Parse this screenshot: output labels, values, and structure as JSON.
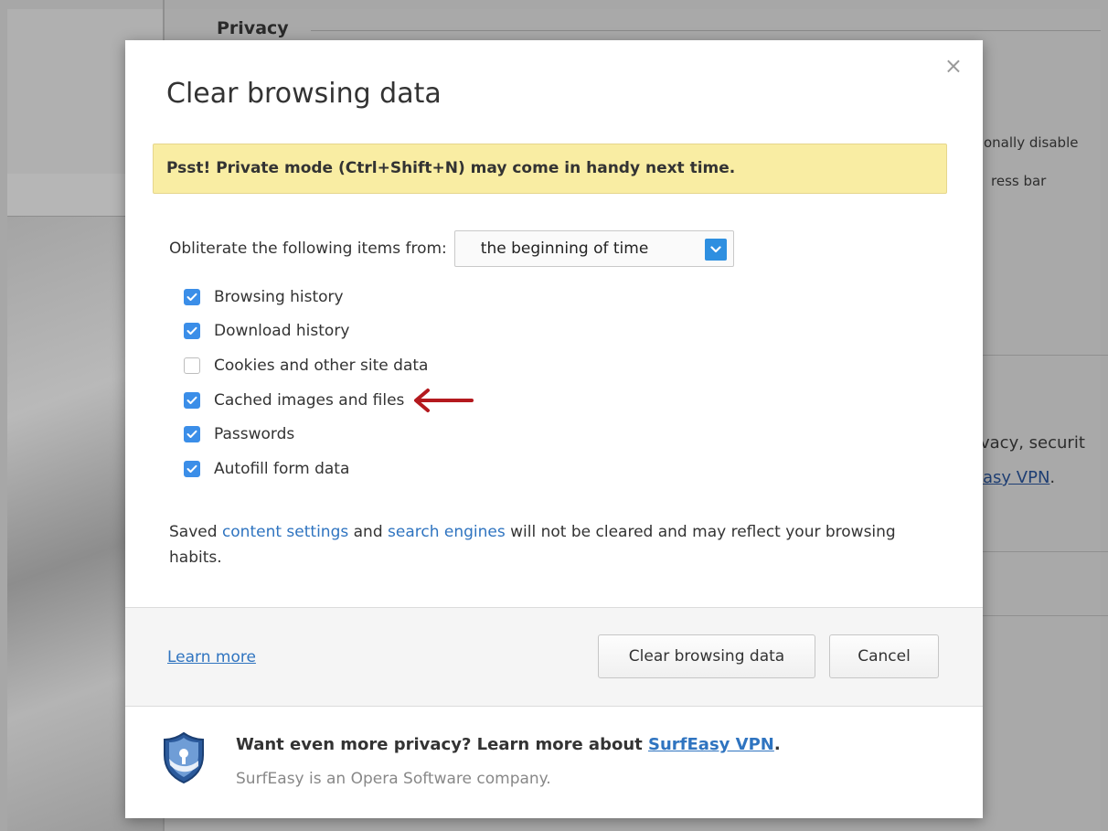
{
  "background": {
    "section_title": "Privacy",
    "fragment_1": "onally disable",
    "fragment_2": "ress bar",
    "fragment_3": "vacy, securit",
    "fragment_4_link": "asy VPN",
    "fragment_4_tail": "."
  },
  "dialog": {
    "title": "Clear browsing data",
    "close_glyph": "×",
    "notice": "Psst! Private mode (Ctrl+Shift+N) may come in handy next time.",
    "period_label": "Obliterate the following items from:",
    "period_value": "the beginning of time",
    "items": [
      {
        "label": "Browsing history",
        "checked": true
      },
      {
        "label": "Download history",
        "checked": true
      },
      {
        "label": "Cookies and other site data",
        "checked": false
      },
      {
        "label": "Cached images and files",
        "checked": true
      },
      {
        "label": "Passwords",
        "checked": true
      },
      {
        "label": "Autofill form data",
        "checked": true
      }
    ],
    "note": {
      "prefix": "Saved ",
      "link1": "content settings",
      "middle": " and ",
      "link2": "search engines",
      "suffix": " will not be cleared and may reflect your browsing habits."
    },
    "footer": {
      "learn_more": "Learn more",
      "clear_button": "Clear browsing data",
      "cancel_button": "Cancel"
    },
    "promo": {
      "headline": "Want even more privacy? Learn more about ",
      "link": "SurfEasy VPN",
      "headline_end": ".",
      "subtitle": "SurfEasy is an Opera Software company."
    }
  },
  "colors": {
    "accent_blue": "#3b8ee8",
    "link_blue": "#2f74c0",
    "notice_bg": "#f9eda3",
    "annotation_arrow": "#b4191e"
  },
  "icons": {
    "close": "close-icon",
    "select_arrow": "chevron-down-icon",
    "check": "checkmark-icon",
    "annotation": "red-arrow-icon",
    "shield": "shield-icon"
  }
}
